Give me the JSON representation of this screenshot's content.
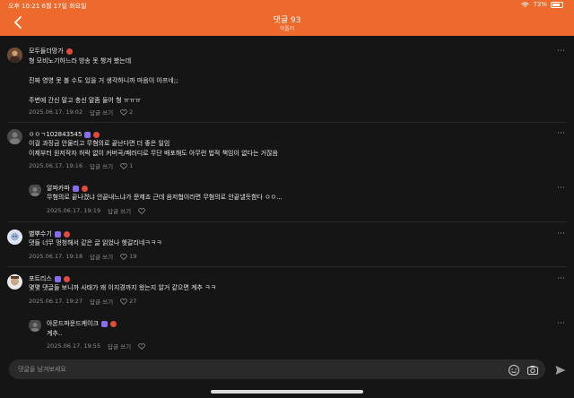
{
  "status_bar": {
    "time": "오후 10:21",
    "date": "6월 17일 화요일",
    "battery": "73%"
  },
  "header": {
    "title": "댓글 93",
    "subtitle": "악플러"
  },
  "reply_label": "답글 쓰기",
  "comments": [
    {
      "user": "모두들더망가",
      "lines": [
        "형 모비노기하느라 방송 못 챙겨 봤는데",
        "",
        "진짜 영영 못 볼 수도 있을 거 생각하니까 마음이 아프네;;",
        "",
        "주변에 간신 말고 충신 말좀 들어 형 ㅠㅠㅠ"
      ],
      "timestamp": "2025.06.17. 19:02",
      "likes": "2"
    },
    {
      "user": "ㅇㅇㄱ102843545",
      "lines": [
        "이걸 과징금 안물리고 무혐의로 끝난다면 더 좋은 일임",
        "이제부터 원저작자 허락 없이 커버곡/패러디로 무단 배포해도 아무런 법적 책임이 없다는 거잖음"
      ],
      "timestamp": "2025.06.17. 19:16",
      "likes": "1"
    },
    {
      "user": "알파카파",
      "lines": [
        "무혐의로 끝나겠냐 안끝내느냐가 문제죠 근데 음저협이라면 무혐의로 안끝낼듯함다 ㅇㅇ..."
      ],
      "timestamp": "2025.06.17. 19:19",
      "likes": ""
    },
    {
      "user": "별뿌수기",
      "lines": [
        "댓들 너무 멍청해서 같은 글 읽었나 헷갈리네ㅋㅋㅋ"
      ],
      "timestamp": "2025.06.17. 19:18",
      "likes": "19"
    },
    {
      "user": "포트리스",
      "lines": [
        "몇몇 댓글들 보니까 사태가 왜 이지경까지 왔는지 알거 같으면 계추 ㅋㅋ"
      ],
      "timestamp": "2025.06.17. 19:27",
      "likes": "27"
    },
    {
      "user": "아몬드파운드케이크",
      "lines": [
        "계추.."
      ],
      "timestamp": "2025.06.17. 19:55",
      "likes": ""
    }
  ],
  "input": {
    "placeholder": "댓글을 남겨보세요"
  },
  "colors": {
    "accent": "#ee6a2c",
    "background": "#151515"
  },
  "icons": [
    "chevron-left-icon",
    "more-icon",
    "heart-icon",
    "emoji-icon",
    "camera-icon",
    "send-icon"
  ]
}
